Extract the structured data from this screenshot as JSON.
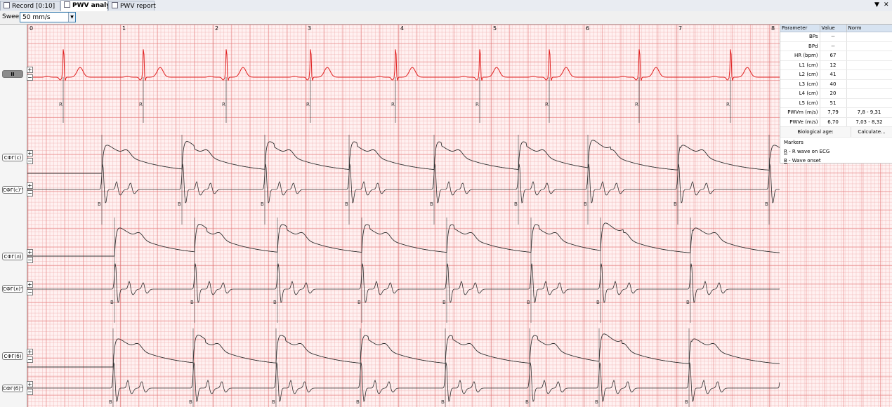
{
  "tabs": [
    {
      "label": "Record [0:10]",
      "active": false
    },
    {
      "label": "PWV analysis",
      "active": true
    },
    {
      "label": "PWV report",
      "active": false
    }
  ],
  "window_controls": {
    "dropdown": "▼",
    "close": "✕"
  },
  "toolbar": {
    "sweep_label": "Sweep",
    "sweep_value": "50 mm/s"
  },
  "channels": [
    {
      "label": "II",
      "selected": true
    },
    {
      "label": "СФГ(с)",
      "selected": false
    },
    {
      "label": "СФГ(с)''",
      "selected": false
    },
    {
      "label": "СФГ(л)",
      "selected": false
    },
    {
      "label": "СФГ(л)''",
      "selected": false
    },
    {
      "label": "СФГ(б)",
      "selected": false
    },
    {
      "label": "СФГ(б)''",
      "selected": false
    }
  ],
  "second_markers": [
    "0",
    "1",
    "2",
    "3",
    "4",
    "5",
    "6",
    "7",
    "8"
  ],
  "marker_letters": {
    "ecg": "R",
    "wave": "B"
  },
  "params_table": {
    "headers": [
      "Parameter",
      "Value",
      "Norm"
    ],
    "rows": [
      {
        "name": "BPs",
        "value": "--",
        "norm": ""
      },
      {
        "name": "BPd",
        "value": "--",
        "norm": ""
      },
      {
        "name": "HR (bpm)",
        "value": "67",
        "norm": ""
      },
      {
        "name": "L1 (cm)",
        "value": "12",
        "norm": ""
      },
      {
        "name": "L2 (cm)",
        "value": "41",
        "norm": ""
      },
      {
        "name": "L3 (cm)",
        "value": "40",
        "norm": ""
      },
      {
        "name": "L4 (cm)",
        "value": "20",
        "norm": ""
      },
      {
        "name": "L5 (cm)",
        "value": "51",
        "norm": ""
      },
      {
        "name": "PWVm (m/s)",
        "value": "7,79",
        "norm": "7,8 - 9,31"
      },
      {
        "name": "PWVe (m/s)",
        "value": "6,70",
        "norm": "7,03 - 8,32"
      }
    ],
    "bio_age_label": "Biological age:",
    "calculate_label": "Calculate..."
  },
  "markers_legend": {
    "title": "Markers",
    "items": [
      {
        "key": "R",
        "text": " - R wave on ECG"
      },
      {
        "key": "B",
        "text": " - Wave onset"
      }
    ]
  },
  "colors": {
    "ecg_trace": "#e02020",
    "pulse_trace": "#303030",
    "marker_line": "#404040",
    "grid_bg": "#fff1f1"
  }
}
